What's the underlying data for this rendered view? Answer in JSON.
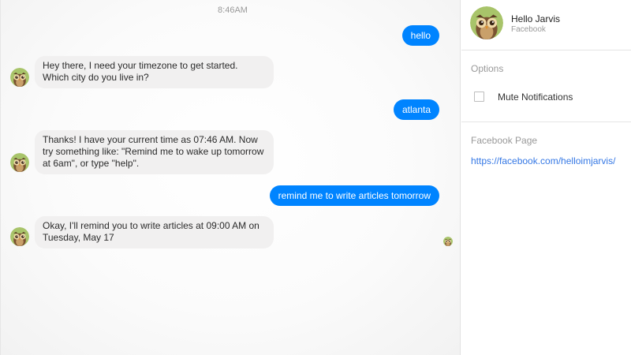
{
  "chat": {
    "timestamp": "8:46AM",
    "messages": [
      {
        "from": "user",
        "text": "hello"
      },
      {
        "from": "bot",
        "text": "Hey there, I need your timezone to get started. Which city do you live in?"
      },
      {
        "from": "user",
        "text": "atlanta"
      },
      {
        "from": "bot",
        "text": "Thanks! I have your current time as 07:46 AM. Now try something like: \"Remind me to wake up tomorrow at 6am\", or type \"help\"."
      },
      {
        "from": "user",
        "text": "remind me to write articles tomorrow"
      },
      {
        "from": "bot",
        "text": "Okay, I'll remind you to write articles at 09:00 AM on Tuesday, May 17"
      }
    ],
    "bot_avatar_icon": "owl-avatar-icon",
    "seen_icon": "owl-seen-icon"
  },
  "sidebar": {
    "contact_name": "Hello Jarvis",
    "contact_source": "Facebook",
    "options_heading": "Options",
    "mute_label": "Mute Notifications",
    "mute_checked": false,
    "facebook_page_heading": "Facebook Page",
    "facebook_page_link": "https://facebook.com/helloimjarvis/"
  },
  "colors": {
    "outgoing_bubble": "#0084ff",
    "incoming_bubble": "#f1f0f0",
    "link": "#3578e5"
  }
}
